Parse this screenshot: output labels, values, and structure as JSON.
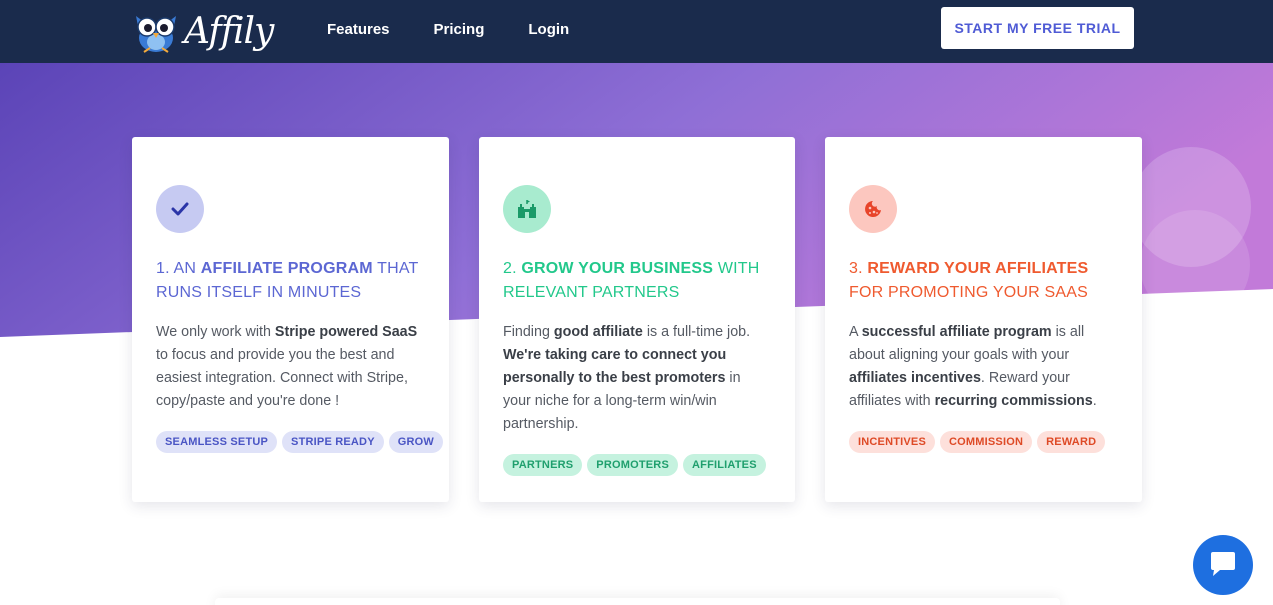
{
  "header": {
    "logo_text": "Affily",
    "nav": [
      "Features",
      "Pricing",
      "Login"
    ],
    "cta_label": "START MY FREE TRIAL"
  },
  "colors": {
    "header_bg": "#1a2b4c",
    "hero_gradient_start": "#5b44b7",
    "hero_gradient_end": "#c27ad9",
    "accent_blue": "#5c67d3",
    "accent_green": "#22c88b",
    "accent_orange": "#ef5a2f",
    "chat_blue": "#1e6fe0"
  },
  "cards": [
    {
      "icon": "checkmark-icon",
      "title_prefix": "1. AN ",
      "title_bold": "AFFILIATE PROGRAM",
      "title_suffix": " THAT RUNS ITSELF IN MINUTES",
      "text": [
        {
          "t": "We only work with ",
          "b": false
        },
        {
          "t": "Stripe powered SaaS",
          "b": true
        },
        {
          "t": " to focus and provide you the best and easiest integration. Connect with Stripe, copy/paste and you're done !",
          "b": false
        }
      ],
      "tags": [
        "SEAMLESS SETUP",
        "STRIPE READY",
        "GROW"
      ]
    },
    {
      "icon": "castle-icon",
      "title_prefix": "2. ",
      "title_bold": "GROW YOUR BUSINESS",
      "title_suffix": " WITH RELEVANT PARTNERS",
      "text": [
        {
          "t": "Finding ",
          "b": false
        },
        {
          "t": "good affiliate",
          "b": true
        },
        {
          "t": " is a full-time job. ",
          "b": false
        },
        {
          "t": "We're taking care to connect you personally to the best promoters",
          "b": true
        },
        {
          "t": " in your niche for a long-term win/win partnership.",
          "b": false
        }
      ],
      "tags": [
        "PARTNERS",
        "PROMOTERS",
        "AFFILIATES"
      ]
    },
    {
      "icon": "cookie-icon",
      "title_prefix": "3. ",
      "title_bold": "REWARD YOUR AFFILIATES",
      "title_suffix": " FOR PROMOTING YOUR SAAS",
      "text": [
        {
          "t": "A ",
          "b": false
        },
        {
          "t": "successful affiliate program",
          "b": true
        },
        {
          "t": " is all about aligning your goals with your ",
          "b": false
        },
        {
          "t": "affiliates incentives",
          "b": true
        },
        {
          "t": ". Reward your affiliates with ",
          "b": false
        },
        {
          "t": "recurring commissions",
          "b": true
        },
        {
          "t": ".",
          "b": false
        }
      ],
      "tags": [
        "INCENTIVES",
        "COMMISSION",
        "REWARD"
      ]
    }
  ],
  "chat_widget": {
    "icon": "chat-bubble-icon"
  }
}
